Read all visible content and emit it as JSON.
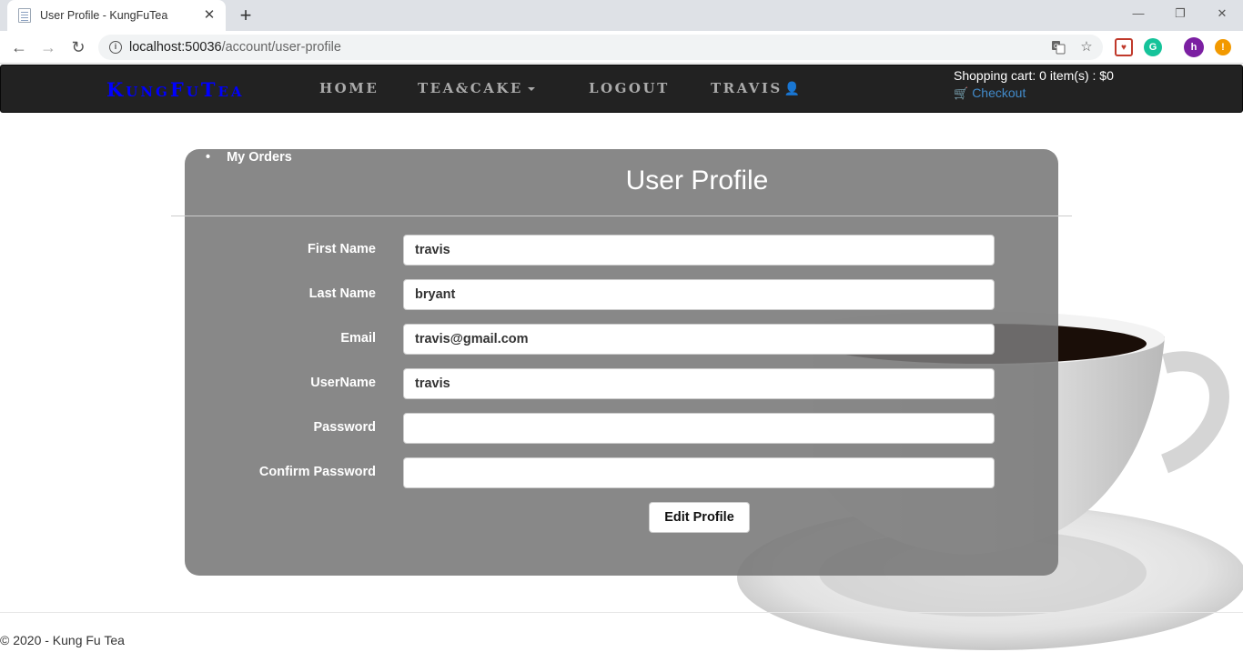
{
  "browser": {
    "tab_title": "User Profile - KungFuTea",
    "tab_close": "✕",
    "new_tab": "+",
    "url_host": "localhost:50036",
    "url_path": "/account/user-profile",
    "profile_initial": "h",
    "alert_badge": "!"
  },
  "nav": {
    "brand": "KungFuTea",
    "links": [
      "Home",
      "Tea&Cake",
      "Logout",
      "Travis"
    ]
  },
  "cart": {
    "summary": "Shopping cart: 0 item(s) : $0",
    "checkout_label": "Checkout"
  },
  "profile": {
    "my_orders": "My Orders",
    "title": "User Profile",
    "fields": [
      {
        "label": "First Name",
        "value": "travis"
      },
      {
        "label": "Last Name",
        "value": "bryant"
      },
      {
        "label": "Email",
        "value": "travis@gmail.com"
      },
      {
        "label": "UserName",
        "value": "travis"
      },
      {
        "label": "Password",
        "value": ""
      },
      {
        "label": "Confirm Password",
        "value": ""
      }
    ],
    "submit_label": "Edit Profile"
  },
  "footer": {
    "text": "© 2020 - Kung Fu Tea"
  },
  "colors": {
    "brand": "#0000ff",
    "navbar": "#222222",
    "link": "#428bca",
    "panel": "#787878"
  }
}
